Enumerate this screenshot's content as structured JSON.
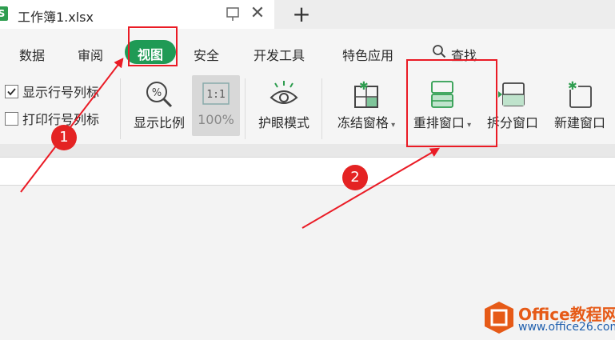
{
  "tab": {
    "app_icon": "S",
    "title": "工作簿1.xlsx",
    "pin_icon": "pin-icon",
    "close_symbol": "✕",
    "add_symbol": "+"
  },
  "menu": {
    "items": [
      "数据",
      "审阅",
      "视图",
      "安全",
      "开发工具",
      "特色应用",
      "查找"
    ],
    "active": "视图"
  },
  "ribbon": {
    "checkboxes": [
      {
        "label": "显示行号列标",
        "checked": true
      },
      {
        "label": "打印行号列标",
        "checked": false
      }
    ],
    "commands": [
      {
        "label": "显示比例",
        "icon": "zoom-icon"
      },
      {
        "label": "100%",
        "icon": "one-to-one-icon"
      },
      {
        "label": "护眼模式",
        "icon": "eye-icon"
      },
      {
        "label": "冻结窗格",
        "icon": "freeze-icon",
        "dropdown": true
      },
      {
        "label": "重排窗口",
        "icon": "arrange-window-icon",
        "dropdown": true
      },
      {
        "label": "拆分窗口",
        "icon": "split-window-icon"
      },
      {
        "label": "新建窗口",
        "icon": "new-window-icon"
      }
    ]
  },
  "annotations": {
    "badge_1": "1",
    "badge_2": "2"
  },
  "watermark": {
    "line1": "Office教程网",
    "line2": "www.office26.com"
  },
  "colors": {
    "accent_green": "#1f9a55",
    "highlight_red": "#ea1b25",
    "watermark_orange": "#e65a17",
    "watermark_blue": "#1f5fad"
  }
}
